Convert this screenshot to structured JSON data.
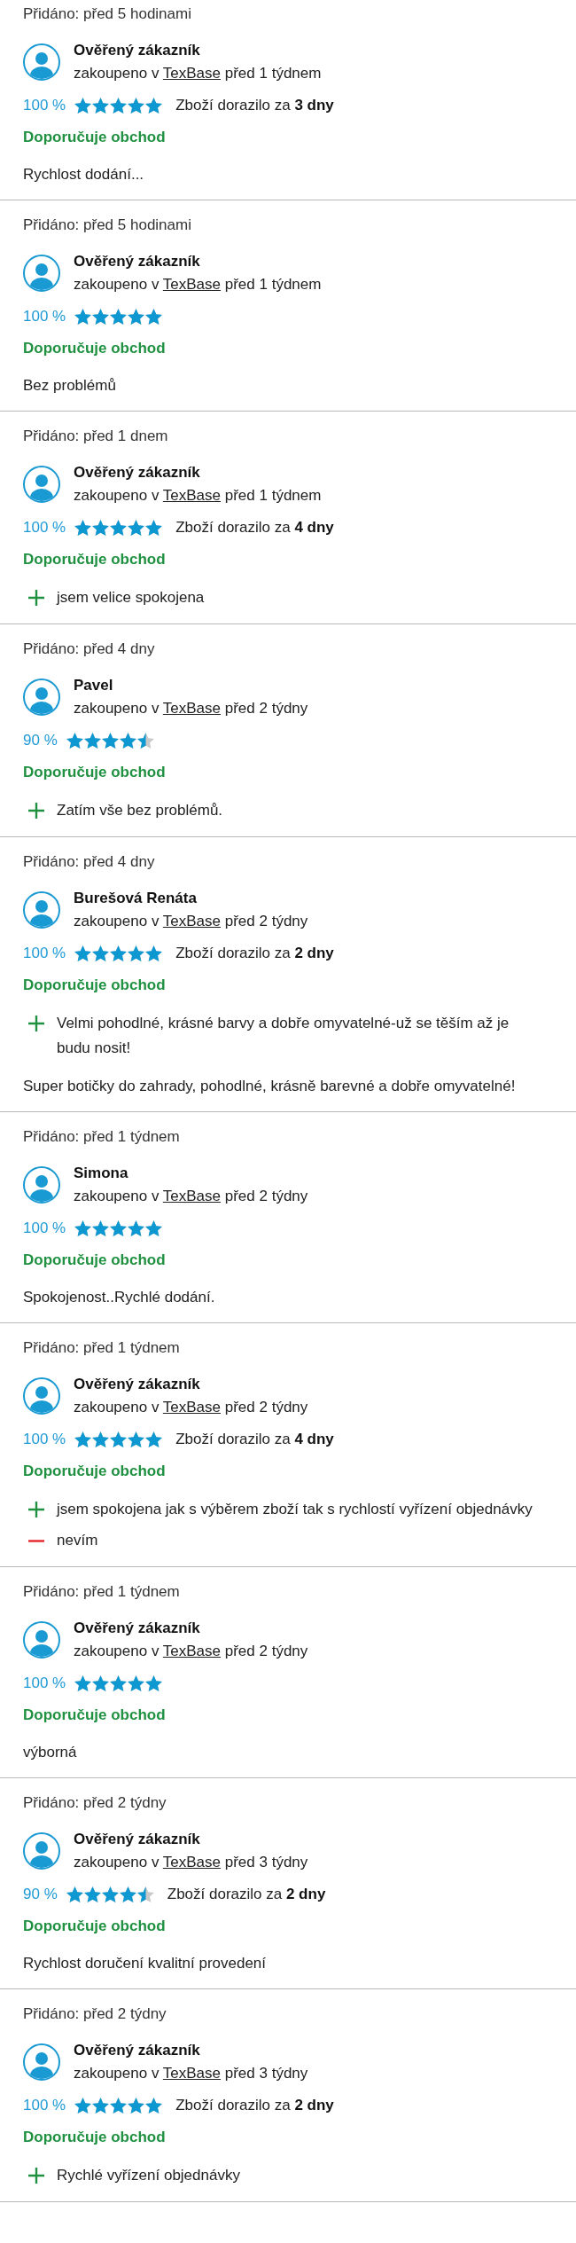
{
  "reviews": [
    {
      "added": "Přidáno: před 5 hodinami",
      "author": "Ověřený zákazník",
      "purchase": {
        "text": "zakoupeno v",
        "shop": "TexBase",
        "time": "před 1 týdnem"
      },
      "percent": "100 %",
      "stars": 5,
      "delivery": "Zboží dorazilo za **3 dny**",
      "recommendation": "Doporučuje obchod",
      "comment": "Rychlost dodání..."
    },
    {
      "added": "Přidáno: před 5 hodinami",
      "author": "Ověřený zákazník",
      "purchase": {
        "text": "zakoupeno v",
        "shop": "TexBase",
        "time": "před 1 týdnem"
      },
      "percent": "100 %",
      "stars": 5,
      "recommendation": "Doporučuje obchod",
      "comment": "Bez problémů"
    },
    {
      "added": "Přidáno: před 1 dnem",
      "author": "Ověřený zákazník",
      "purchase": {
        "text": "zakoupeno v",
        "shop": "TexBase",
        "time": "před 1 týdnem"
      },
      "percent": "100 %",
      "stars": 5,
      "delivery": "Zboží dorazilo za **4 dny**",
      "recommendation": "Doporučuje obchod",
      "points": [
        {
          "kind": "pro",
          "text": "jsem velice spokojena"
        }
      ]
    },
    {
      "added": "Přidáno: před 4 dny",
      "author": "Pavel",
      "purchase": {
        "text": "zakoupeno v",
        "shop": "TexBase",
        "time": "před 2 týdny"
      },
      "percent": "90 %",
      "stars": 4.5,
      "recommendation": "Doporučuje obchod",
      "points": [
        {
          "kind": "pro",
          "text": "Zatím vše bez problémů."
        }
      ]
    },
    {
      "added": "Přidáno: před 4 dny",
      "author": "Burešová Renáta",
      "purchase": {
        "text": "zakoupeno v",
        "shop": "TexBase",
        "time": "před 2 týdny"
      },
      "percent": "100 %",
      "stars": 5,
      "delivery": "Zboží dorazilo za **2 dny**",
      "recommendation": "Doporučuje obchod",
      "points": [
        {
          "kind": "pro",
          "text": "Velmi pohodlné, krásné barvy a dobře omyvatelné-už se těším až je budu nosit!"
        }
      ],
      "comment": "Super botičky do zahrady, pohodlné, krásně barevné a dobře omyvatelné!"
    },
    {
      "added": "Přidáno: před 1 týdnem",
      "author": "Simona",
      "purchase": {
        "text": "zakoupeno v",
        "shop": "TexBase",
        "time": "před 2 týdny"
      },
      "percent": "100 %",
      "stars": 5,
      "recommendation": "Doporučuje obchod",
      "comment": "Spokojenost..Rychlé dodání."
    },
    {
      "added": "Přidáno: před 1 týdnem",
      "author": "Ověřený zákazník",
      "purchase": {
        "text": "zakoupeno v",
        "shop": "TexBase",
        "time": "před 2 týdny"
      },
      "percent": "100 %",
      "stars": 5,
      "delivery": "Zboží dorazilo za **4 dny**",
      "recommendation": "Doporučuje obchod",
      "points": [
        {
          "kind": "pro",
          "text": "jsem spokojena jak s výběrem zboží tak s rychlostí vyřízení objednávky"
        },
        {
          "kind": "con",
          "text": "nevím"
        }
      ]
    },
    {
      "added": "Přidáno: před 1 týdnem",
      "author": "Ověřený zákazník",
      "purchase": {
        "text": "zakoupeno v",
        "shop": "TexBase",
        "time": "před 2 týdny"
      },
      "percent": "100 %",
      "stars": 5,
      "recommendation": "Doporučuje obchod",
      "comment": "výborná"
    },
    {
      "added": "Přidáno: před 2 týdny",
      "author": "Ověřený zákazník",
      "purchase": {
        "text": "zakoupeno v",
        "shop": "TexBase",
        "time": "před 3 týdny"
      },
      "percent": "90 %",
      "stars": 4.5,
      "delivery": "Zboží dorazilo za **2 dny**",
      "recommendation": "Doporučuje obchod",
      "comment": "Rychlost doručení kvalitní provedení"
    },
    {
      "added": "Přidáno: před 2 týdny",
      "author": "Ověřený zákazník",
      "purchase": {
        "text": "zakoupeno v",
        "shop": "TexBase",
        "time": "před 3 týdny"
      },
      "percent": "100 %",
      "stars": 5,
      "delivery": "Zboží dorazilo za **2 dny**",
      "recommendation": "Doporučuje obchod",
      "points": [
        {
          "kind": "pro",
          "text": "Rychlé vyřízení objednávky"
        }
      ]
    }
  ]
}
